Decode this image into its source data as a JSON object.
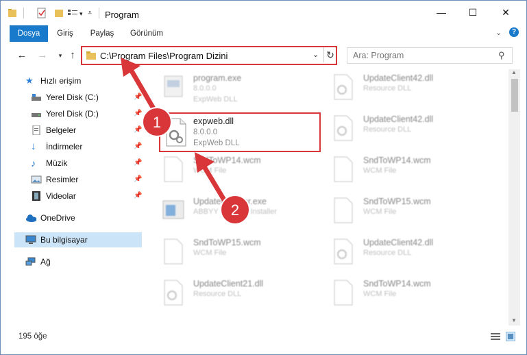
{
  "window": {
    "title": "Program"
  },
  "ribbon": {
    "tabs": [
      "Dosya",
      "Giriş",
      "Paylaş",
      "Görünüm"
    ]
  },
  "address": {
    "path": "C:\\Program Files\\Program Dizini"
  },
  "search": {
    "placeholder": "Ara: Program"
  },
  "sidebar": {
    "items": [
      {
        "label": "Hızlı erişim",
        "icon": "star-icon"
      },
      {
        "label": "Yerel Disk (C:)",
        "icon": "drive-icon"
      },
      {
        "label": "Yerel Disk (D:)",
        "icon": "drive-icon"
      },
      {
        "label": "Belgeler",
        "icon": "documents-icon"
      },
      {
        "label": "İndirmeler",
        "icon": "download-icon"
      },
      {
        "label": "Müzik",
        "icon": "music-icon"
      },
      {
        "label": "Resimler",
        "icon": "pictures-icon"
      },
      {
        "label": "Videolar",
        "icon": "videos-icon"
      },
      {
        "label": "OneDrive",
        "icon": "cloud-icon"
      },
      {
        "label": "Bu bilgisayar",
        "icon": "computer-icon"
      },
      {
        "label": "Ağ",
        "icon": "network-icon"
      }
    ]
  },
  "files_left": [
    {
      "name": "program.exe",
      "l2": "8.0.0.0",
      "l3": "ExpWeb DLL"
    },
    {
      "name": "expweb.dll",
      "l2": "8.0.0.0",
      "l3": "ExpWeb DLL"
    },
    {
      "name": "SndToWP14.wcm",
      "l2": "WCM File",
      "l3": ""
    },
    {
      "name": "UpdateInstaller.exe",
      "l2": "ABBYY Updates Installer",
      "l3": ""
    },
    {
      "name": "SndToWP15.wcm",
      "l2": "WCM File",
      "l3": ""
    },
    {
      "name": "UpdateClient21.dll",
      "l2": "Resource DLL",
      "l3": ""
    }
  ],
  "files_right": [
    {
      "name": "UpdateClient42.dll",
      "l2": "Resource DLL"
    },
    {
      "name": "UpdateClient42.dll",
      "l2": "Resource DLL"
    },
    {
      "name": "SndToWP14.wcm",
      "l2": "WCM File"
    },
    {
      "name": "SndToWP15.wcm",
      "l2": "WCM File"
    },
    {
      "name": "UpdateClient42.dll",
      "l2": "Resource DLL"
    },
    {
      "name": "SndToWP14.wcm",
      "l2": "WCM File"
    }
  ],
  "status": {
    "count": "195 öğe"
  },
  "callouts": [
    "1",
    "2"
  ],
  "colors": {
    "accent": "#1979ca",
    "highlight": "#d9363a",
    "selected": "#cce4f7"
  }
}
